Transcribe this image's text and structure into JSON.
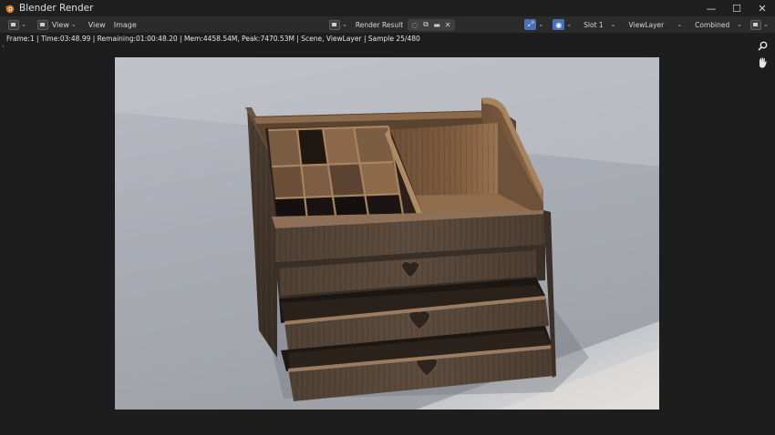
{
  "window": {
    "title": "Blender Render",
    "controls": {
      "minimize": "—",
      "maximize": "☐",
      "close": "✕"
    }
  },
  "header": {
    "view_menu": "View",
    "view_label": "View",
    "image_label": "Image",
    "render_result_label": "Render Result",
    "slot": "Slot 1",
    "view_layer": "ViewLayer",
    "pass": "Combined"
  },
  "status_line": "Frame:1 | Time:03:48.99 | Remaining:01:00:48.20 | Mem:4458.54M, Peak:7470.53M | Scene, ViewLayer | Sample 25/480",
  "icons": {
    "app": "blender-logo-icon",
    "editor_type": "image-editor-icon",
    "zoom": "zoom-icon",
    "pan": "hand-pan-icon"
  },
  "colors": {
    "accent": "#4772b3",
    "logo": "#e87d0d"
  }
}
